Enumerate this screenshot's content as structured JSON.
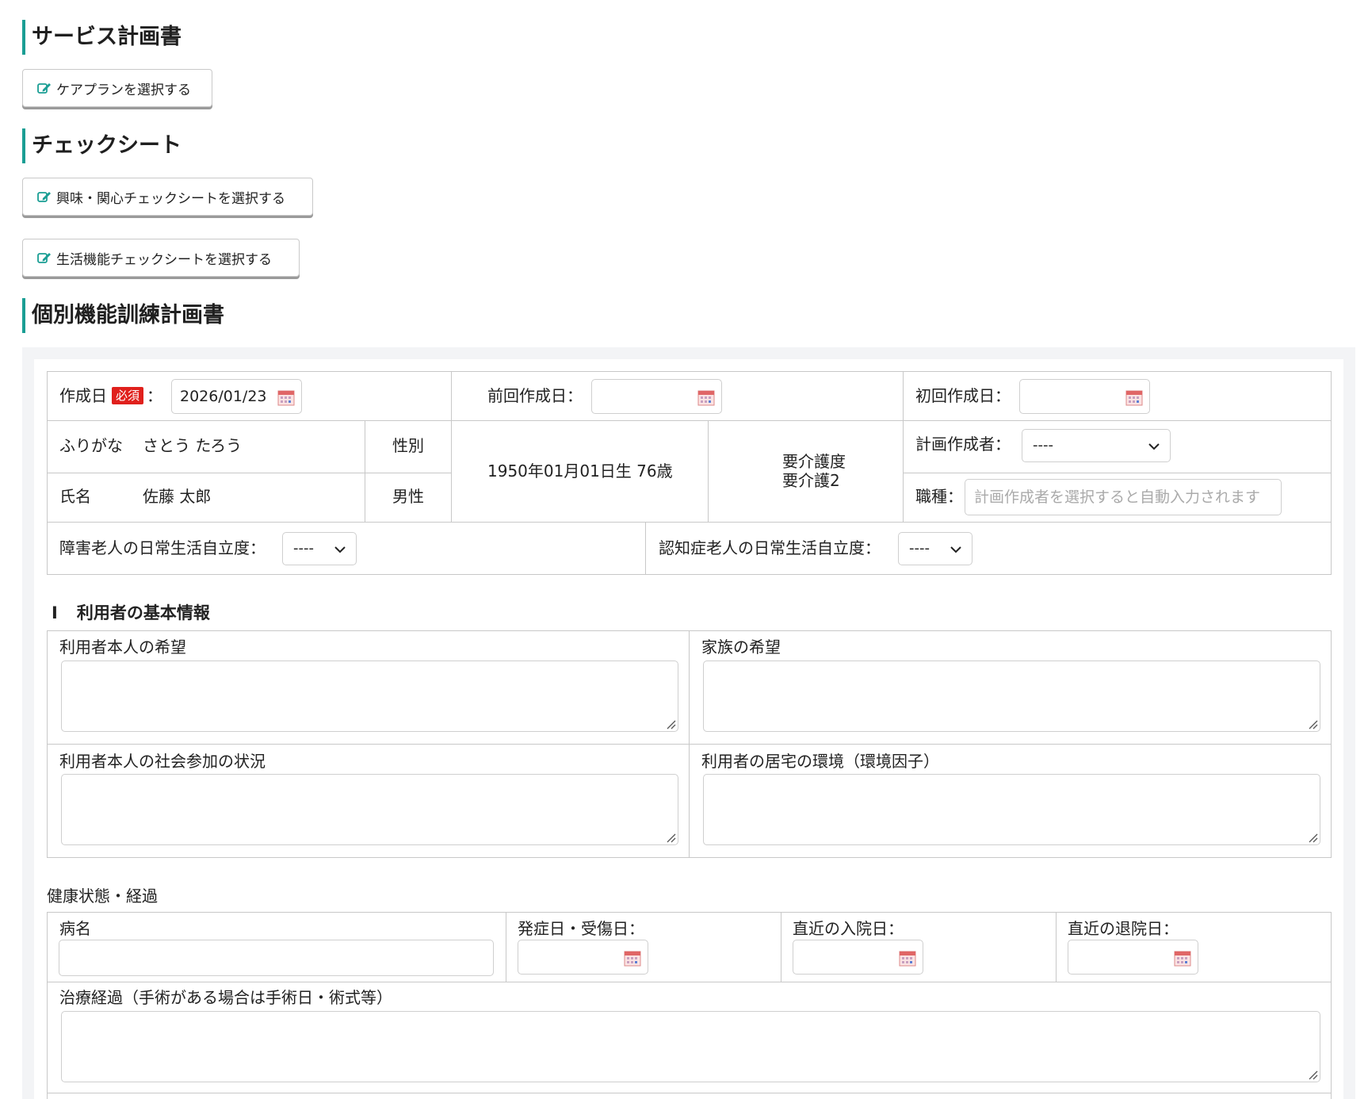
{
  "sections": {
    "service_plan": {
      "title": "サービス計画書",
      "button": "ケアプランを選択する"
    },
    "check_sheet": {
      "title": "チェックシート",
      "button_interest": "興味・関心チェックシートを選択する",
      "button_life": "生活機能チェックシートを選択する"
    },
    "training_plan": {
      "title": "個別機能訓練計画書"
    }
  },
  "form": {
    "created_label": "作成日",
    "required_badge": "必須",
    "colon": "：",
    "created_value": "2026/01/23",
    "prev_created_label": "前回作成日：",
    "prev_created_value": "",
    "first_created_label": "初回作成日：",
    "first_created_value": "",
    "furigana_label": "ふりがな",
    "furigana_value": "さとう たろう",
    "gender_label": "性別",
    "gender_value": "男性",
    "name_label": "氏名",
    "name_value": "佐藤 太郎",
    "birth": "1950年01月01日生 76歳",
    "care_level_label": "要介護度",
    "care_level_value": "要介護2",
    "planner_label": "計画作成者：",
    "planner_value": "----",
    "job_label": "職種：",
    "job_placeholder": "計画作成者を選択すると自動入力されます",
    "disability_label": "障害老人の日常生活自立度：",
    "disability_value": "----",
    "dementia_label": "認知症老人の日常生活自立度：",
    "dementia_value": "----"
  },
  "basic_info": {
    "heading_num": "Ⅰ",
    "heading": "利用者の基本情報",
    "wish_user": "利用者本人の希望",
    "wish_family": "家族の希望",
    "social": "利用者本人の社会参加の状況",
    "home_env": "利用者の居宅の環境（環境因子）"
  },
  "health": {
    "heading": "健康状態・経過",
    "disease": "病名",
    "onset": "発症日・受傷日：",
    "admission": "直近の入院日：",
    "discharge": "直近の退院日：",
    "treatment": "治療経過（手術がある場合は手術日・術式等）"
  },
  "colors": {
    "accent": "#1a9e94",
    "required": "#e0201c",
    "border": "#c8c8c8"
  },
  "icons": {
    "edit": "edit-icon",
    "calendar": "calendar-icon",
    "chevron": "chevron-down-icon",
    "resize": "resize-grip-icon"
  }
}
